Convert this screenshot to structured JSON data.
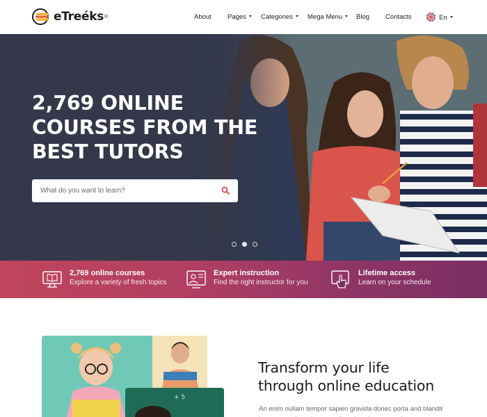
{
  "brand": {
    "name": "eTreéks",
    "reg": "®"
  },
  "nav": {
    "items": [
      {
        "label": "About",
        "caret": false
      },
      {
        "label": "Pages",
        "caret": true
      },
      {
        "label": "Categories",
        "caret": true
      },
      {
        "label": "Mega Menu",
        "caret": true
      },
      {
        "label": "Blog",
        "caret": false
      },
      {
        "label": "Contacts",
        "caret": false
      }
    ],
    "language": {
      "label": "En",
      "icon": "uk-flag-icon"
    }
  },
  "hero": {
    "title_lines": [
      "2,769 ONLINE",
      "COURSES FROM THE",
      "BEST TUTORS"
    ],
    "search": {
      "placeholder": "What do you want to learn?",
      "value": "",
      "icon": "search-icon"
    },
    "slider": {
      "count": 3,
      "active_index": 1
    }
  },
  "features": [
    {
      "icon": "monitor-book-icon",
      "title": "2,769 online courses",
      "subtitle": "Explore a variety of fresh topics"
    },
    {
      "icon": "instructor-board-icon",
      "title": "Expert instruction",
      "subtitle": "Find the right instructor for you"
    },
    {
      "icon": "lifetime-access-icon",
      "title": "Lifetime access",
      "subtitle": "Learn on your schedule"
    }
  ],
  "about": {
    "title_lines": [
      "Transform your life",
      "through online education"
    ],
    "text": "An enim nullam tempor sapien gravida donec porta and blandit ipsum porta justo integer odio velna vitae auctor integer congue magna"
  },
  "colors": {
    "accent": "#e03a3a",
    "features_band_start": "#c1455d",
    "features_band_end": "#7b2f62",
    "hero_dark": "#34384a"
  }
}
